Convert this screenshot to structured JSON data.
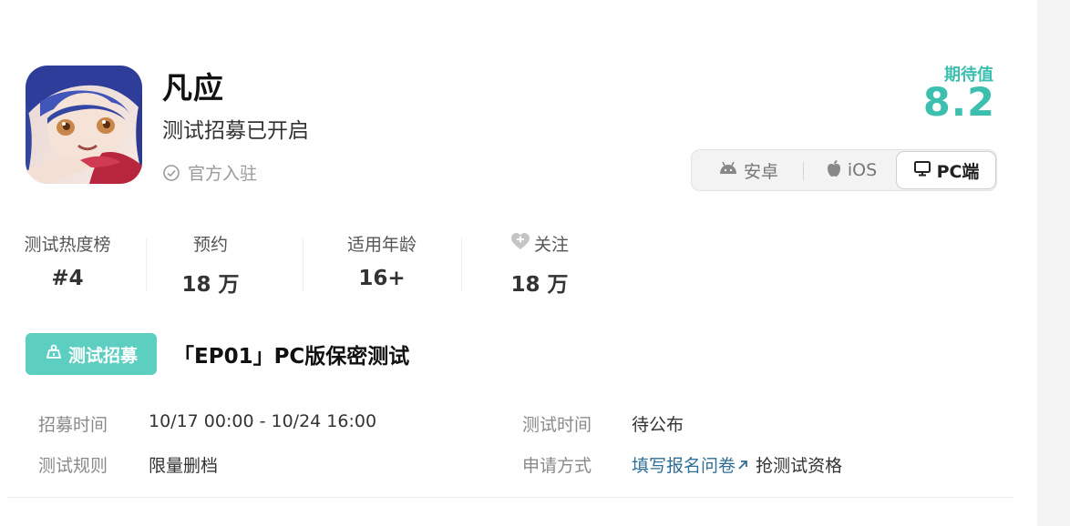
{
  "header": {
    "title": "凡应",
    "subtitle": "测试招募已开启",
    "verified_label": "官方入驻"
  },
  "score": {
    "label": "期待值",
    "value": "8.2"
  },
  "platforms": [
    {
      "label": "安卓",
      "icon": "android-icon",
      "selected": false
    },
    {
      "label": "iOS",
      "icon": "apple-icon",
      "selected": false
    },
    {
      "label": "PC端",
      "icon": "monitor-icon",
      "selected": true
    }
  ],
  "stats": {
    "rank": {
      "label": "测试热度榜",
      "value": "#4"
    },
    "reserve": {
      "label": "预约",
      "value": "18 万"
    },
    "age": {
      "label": "适用年龄",
      "value": "16+"
    },
    "follow": {
      "label": "关注",
      "value": "18 万",
      "icon": "heart-icon"
    }
  },
  "recruit": {
    "badge": "测试招募",
    "title": "「EP01」PC版保密测试",
    "recruit_time_label": "招募时间",
    "recruit_time_value": "10/17 00:00 - 10/24 16:00",
    "rules_label": "测试规则",
    "rules_value": "限量删档",
    "test_time_label": "测试时间",
    "test_time_value": "待公布",
    "apply_label": "申请方式",
    "apply_link": "填写报名问卷",
    "apply_suffix": "抢测试资格"
  },
  "colors": {
    "accent": "#3cbfae",
    "badge": "#5ccfc0",
    "link": "#2f6e96"
  }
}
